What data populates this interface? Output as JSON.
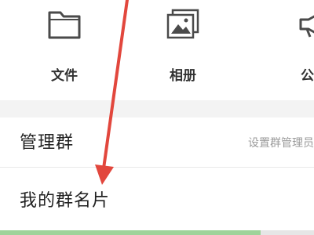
{
  "grid": {
    "items": [
      {
        "label": "文件",
        "icon": "folder-icon"
      },
      {
        "label": "相册",
        "icon": "album-icon"
      },
      {
        "label": "公告",
        "icon": "megaphone-icon"
      }
    ]
  },
  "settings": {
    "manage_label": "管理群",
    "manage_hint": "设置群管理员",
    "card_label": "我的群名片"
  },
  "colors": {
    "arrow": "#e2473d",
    "bottom_bar": "#9fd39a",
    "divider": "#f3f3f3"
  }
}
